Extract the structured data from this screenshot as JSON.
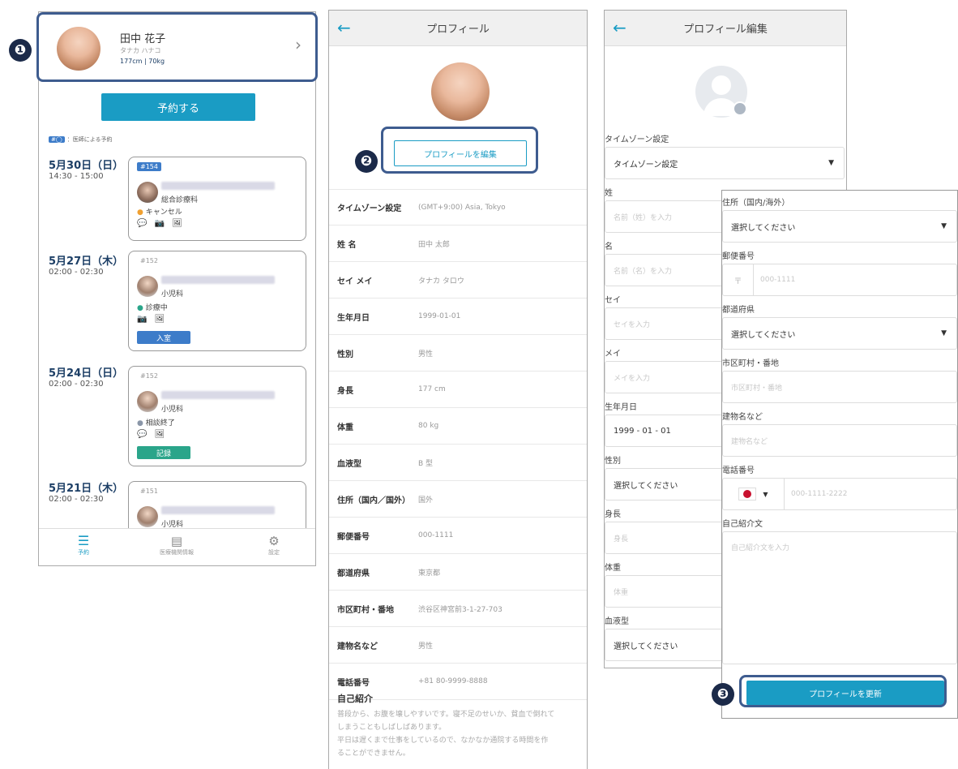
{
  "screen1": {
    "profile": {
      "name": "田中 花子",
      "kana": "タナカ ハナコ",
      "stats": "177cm | 70kg",
      "chevron": "›"
    },
    "reserve_button": "予約する",
    "legend": {
      "tag": "#◯",
      "text": "：医師による予約"
    },
    "appointments": [
      {
        "date": "5月30日（日）",
        "time": "14:30 - 15:00",
        "id": "#154",
        "dept": "総合診療科",
        "status": "キャンセル",
        "status_color": "#f0a030",
        "action": ""
      },
      {
        "date": "5月27日（木）",
        "time": "02:00 - 02:30",
        "id": "#152",
        "dept": "小児科",
        "status": "診療中",
        "status_color": "#2aa58a",
        "action": "入室",
        "action_color": "#3d7cc9"
      },
      {
        "date": "5月24日（日）",
        "time": "02:00 - 02:30",
        "id": "#152",
        "dept": "小児科",
        "status": "相談終了",
        "status_color": "#8a96a8",
        "action": "記録",
        "action_color": "#2aa58a"
      },
      {
        "date": "5月21日（木）",
        "time": "02:00 - 02:30",
        "id": "#151",
        "dept": "小児科",
        "status": "",
        "action": ""
      }
    ],
    "nav": [
      {
        "label": "予約",
        "icon": "list-icon"
      },
      {
        "label": "医療機関情報",
        "icon": "clipboard-icon"
      },
      {
        "label": "設定",
        "icon": "gear-icon"
      }
    ]
  },
  "screen2": {
    "title": "プロフィール",
    "edit_button": "プロフィールを編集",
    "rows": [
      {
        "label": "タイムゾーン設定",
        "value": "(GMT+9:00) Asia, Tokyo"
      },
      {
        "label": "姓 名",
        "value": "田中 太郎"
      },
      {
        "label": "セイ メイ",
        "value": "タナカ タロウ"
      },
      {
        "label": "生年月日",
        "value": "1999-01-01"
      },
      {
        "label": "性別",
        "value": "男性"
      },
      {
        "label": "身長",
        "value": "177 cm"
      },
      {
        "label": "体重",
        "value": "80 kg"
      },
      {
        "label": "血液型",
        "value": "B 型"
      },
      {
        "label": "住所（国内／国外）",
        "value": "国外"
      },
      {
        "label": "郵便番号",
        "value": "000-1111"
      },
      {
        "label": "都道府県",
        "value": "東京都"
      },
      {
        "label": "市区町村・番地",
        "value": "渋谷区神宮前3-1-27-703"
      },
      {
        "label": "建物名など",
        "value": "男性"
      },
      {
        "label": "電話番号",
        "value": "+81 80-9999-8888"
      }
    ],
    "intro_label": "自己紹介",
    "intro_lines": [
      "普段から、お腹を壊しやすいです。寝不足のせいか、貧血で倒れて",
      "しまうこともしばしばあります。",
      "平日は遅くまで仕事をしているので、なかなか通院する時間を作",
      "ることができません。"
    ]
  },
  "screen3": {
    "title": "プロフィール編集",
    "fields": [
      {
        "label": "タイムゾーン設定",
        "value": "タイムゾーン設定",
        "type": "select"
      },
      {
        "label": "姓",
        "placeholder": "名前（姓）を入力"
      },
      {
        "label": "名",
        "placeholder": "名前（名）を入力"
      },
      {
        "label": "セイ",
        "placeholder": "セイを入力"
      },
      {
        "label": "メイ",
        "placeholder": "メイを入力"
      },
      {
        "label": "生年月日",
        "value": "1999 - 01 - 01"
      },
      {
        "label": "性別",
        "value": "選択してください"
      },
      {
        "label": "身長",
        "placeholder": "身長"
      },
      {
        "label": "体重",
        "placeholder": "体重"
      },
      {
        "label": "血液型",
        "value": "選択してください"
      }
    ]
  },
  "screen4": {
    "fields": [
      {
        "label": "住所（国内/海外）",
        "value": "選択してください"
      },
      {
        "label": "郵便番号",
        "prefix": "〒",
        "placeholder": "000-1111"
      },
      {
        "label": "都道府県",
        "value": "選択してください"
      },
      {
        "label": "市区町村・番地",
        "placeholder": "市区町村・番地"
      },
      {
        "label": "建物名など",
        "placeholder": "建物名など"
      },
      {
        "label": "電話番号",
        "placeholder": "000-1111-2222"
      },
      {
        "label": "自己紹介文",
        "placeholder": "自己紹介文を入力"
      }
    ],
    "update_button": "プロフィールを更新"
  },
  "markers": [
    "❶",
    "❷",
    "❸"
  ],
  "colors": {
    "primary": "#1a9cc4",
    "navy": "#1d3f66",
    "highlight": "#3e5c8f"
  }
}
